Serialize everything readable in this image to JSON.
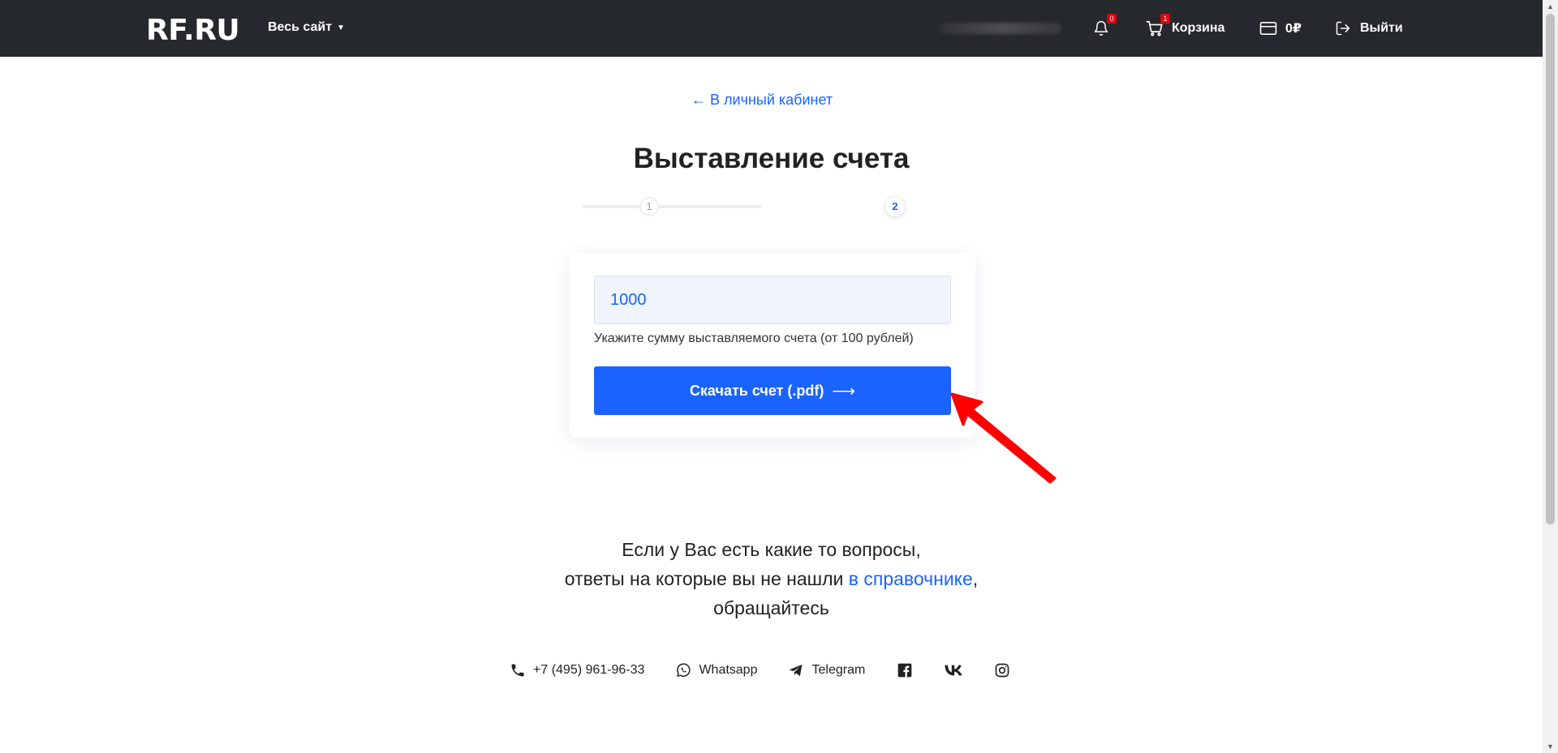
{
  "header": {
    "logo": "RF.RU",
    "site_menu": "Весь сайт",
    "notifications_count": "0",
    "cart_count": "1",
    "cart_label": "Корзина",
    "balance": "0₽",
    "logout_label": "Выйти"
  },
  "main": {
    "back_link": "← В личный кабинет",
    "title": "Выставление счета",
    "steps": [
      "1",
      "2"
    ],
    "active_step": 2,
    "amount_value": "1000",
    "hint": "Укажите сумму выставляемого счета (от 100 рублей)",
    "download_label": "Скачать счет (.pdf)",
    "download_arrow": "⟶"
  },
  "help": {
    "line1": "Если у Вас есть какие то вопросы,",
    "line2_prefix": "ответы на которые вы не нашли ",
    "line2_link": "в справочнике",
    "line2_suffix": ",",
    "line3": "обращайтесь"
  },
  "contacts": {
    "phone": "+7 (495) 961-96-33",
    "whatsapp": "Whatsapp",
    "telegram": "Telegram"
  },
  "colors": {
    "header_bg": "#25282c",
    "accent": "#1a63ff",
    "badge": "#e3000f",
    "annotation_arrow": "#ff0000"
  }
}
